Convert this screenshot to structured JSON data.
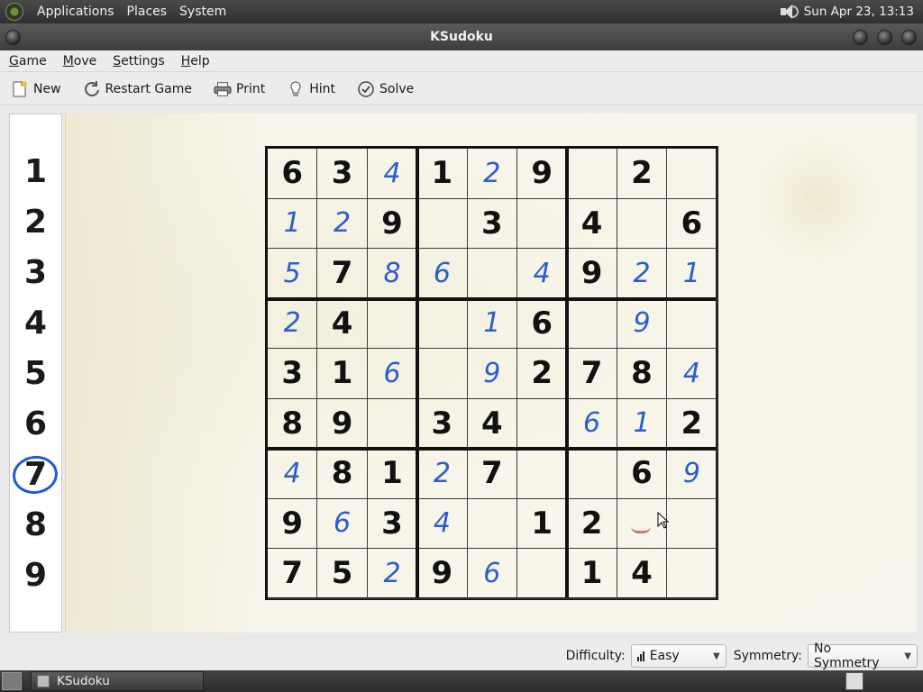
{
  "top_panel": {
    "menus": [
      "Applications",
      "Places",
      "System"
    ],
    "clock": "Sun Apr 23, 13:13"
  },
  "window": {
    "title": "KSudoku"
  },
  "menubar": {
    "items": [
      {
        "first": "G",
        "rest": "ame"
      },
      {
        "first": "M",
        "rest": "ove"
      },
      {
        "first": "S",
        "rest": "ettings"
      },
      {
        "first": "H",
        "rest": "elp"
      }
    ]
  },
  "toolbar": {
    "new_label": "New",
    "restart_label": "Restart Game",
    "print_label": "Print",
    "hint_label": "Hint",
    "solve_label": "Solve"
  },
  "selector": {
    "numbers": [
      "1",
      "2",
      "3",
      "4",
      "5",
      "6",
      "7",
      "8",
      "9"
    ],
    "selected": "7"
  },
  "board": {
    "rows": [
      [
        "6g",
        "3g",
        "4u",
        "1g",
        "2u",
        "9g",
        "",
        "2g",
        ""
      ],
      [
        "1u",
        "2u",
        "9g",
        "",
        "3g",
        "",
        "4g",
        "",
        "6g"
      ],
      [
        "5u",
        "7g",
        "8u",
        "6u",
        "",
        "4u",
        "9g",
        "2u",
        "1u"
      ],
      [
        "2u",
        "4g",
        "",
        "",
        "1u",
        "6g",
        "",
        "9u",
        ""
      ],
      [
        "3g",
        "1g",
        "6u",
        "",
        "9u",
        "2g",
        "7g",
        "8g",
        "4u"
      ],
      [
        "8g",
        "9g",
        "",
        "3g",
        "4g",
        "",
        "6u",
        "1u",
        "2g"
      ],
      [
        "4u",
        "8g",
        "1g",
        "2u",
        "7g",
        "",
        "",
        "6g",
        "9u"
      ],
      [
        "9g",
        "6u",
        "3g",
        "4u",
        "",
        "1g",
        "2g",
        "",
        ""
      ],
      [
        "7g",
        "5g",
        "2u",
        "9g",
        "6u",
        "",
        "1g",
        "4g",
        ""
      ]
    ]
  },
  "status": {
    "difficulty_label": "Difficulty:",
    "difficulty_value": "Easy",
    "symmetry_label": "Symmetry:",
    "symmetry_value": "No Symmetry"
  },
  "taskbar": {
    "task_label": "KSudoku"
  }
}
